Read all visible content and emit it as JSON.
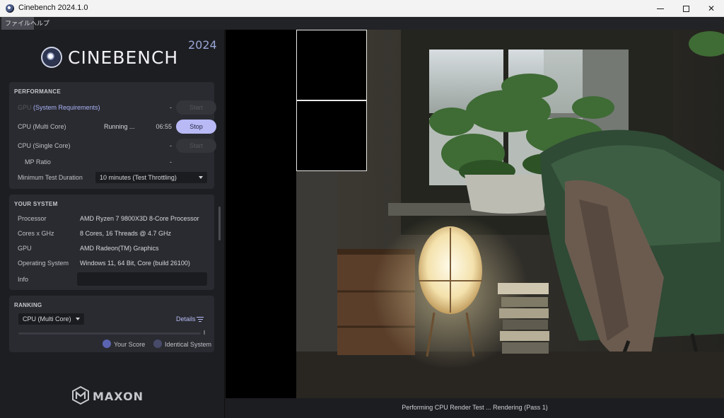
{
  "window": {
    "title": "Cinebench 2024.1.0"
  },
  "menu": {
    "file": "ファイル",
    "help": "ヘルプ"
  },
  "brand": {
    "logo_text": "CINEBENCH",
    "year": "2024",
    "footer_logo": "MAXON"
  },
  "performance": {
    "title": "PERFORMANCE",
    "gpu_label": "GPU",
    "gpu_link": "(System Requirements)",
    "gpu_time": "-",
    "gpu_button": "Start",
    "cpu_multi_label": "CPU (Multi Core)",
    "cpu_multi_status": "Running ...",
    "cpu_multi_time": "06:55",
    "cpu_multi_button": "Stop",
    "cpu_single_label": "CPU (Single Core)",
    "cpu_single_time": "-",
    "cpu_single_button": "Start",
    "mp_ratio_label": "MP Ratio",
    "mp_ratio_value": "-",
    "min_duration_label": "Minimum Test Duration",
    "min_duration_value": "10 minutes (Test Throttling)"
  },
  "system": {
    "title": "YOUR SYSTEM",
    "rows": [
      {
        "label": "Processor",
        "value": "AMD Ryzen 7 9800X3D 8-Core Processor"
      },
      {
        "label": "Cores x GHz",
        "value": "8 Cores, 16 Threads @ 4.7 GHz"
      },
      {
        "label": "GPU",
        "value": "AMD Radeon(TM) Graphics"
      },
      {
        "label": "Operating System",
        "value": "Windows 11, 64 Bit, Core (build 26100)"
      }
    ],
    "info_label": "Info",
    "info_value": ""
  },
  "ranking": {
    "title": "RANKING",
    "selected": "CPU (Multi Core)",
    "details": "Details",
    "legend_your_score": "Your Score",
    "legend_identical": "Identical System"
  },
  "status": {
    "text": "Performing CPU Render Test ... Rendering (Pass 1)"
  },
  "colors": {
    "accent": "#b8b9f5",
    "link": "#a9b2f4",
    "panel": "#2a2b31"
  }
}
